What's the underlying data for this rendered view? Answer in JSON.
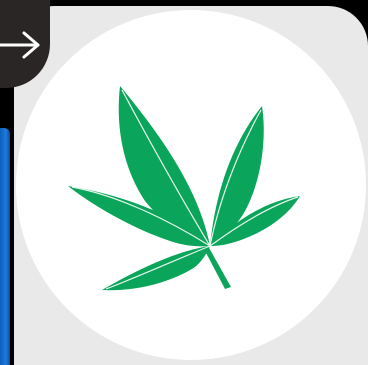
{
  "colors": {
    "background": "#000000",
    "card": "#e9e9e9",
    "disc": "#ffffff",
    "leaf_green": "#0aa55a",
    "vein": "#ffffff",
    "accent_blue": "#1d7be0",
    "button_dark": "#2a2626"
  },
  "icons": {
    "back": "right-arrow-icon",
    "emblem": "leaf-icon"
  }
}
